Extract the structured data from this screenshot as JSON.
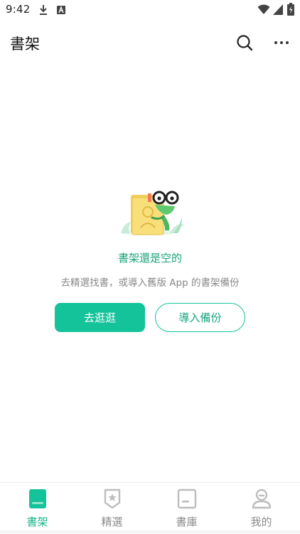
{
  "status_bar": {
    "time": "9:42",
    "icons": [
      "download-icon",
      "a-box-icon",
      "wifi-icon",
      "signal-icon",
      "battery-charging-icon"
    ]
  },
  "header": {
    "title": "書架",
    "search_icon": "search-icon",
    "more_icon": "more-horizontal-icon"
  },
  "empty_state": {
    "title": "書架還是空的",
    "subtitle": "去精選找書，或導入舊版 App 的書架備份",
    "primary_button": "去逛逛",
    "secondary_button": "導入備份"
  },
  "bottom_nav": {
    "items": [
      {
        "label": "書架",
        "icon": "bookshelf-icon",
        "active": true
      },
      {
        "label": "精選",
        "icon": "badge-star-icon",
        "active": false
      },
      {
        "label": "書庫",
        "icon": "library-icon",
        "active": false
      },
      {
        "label": "我的",
        "icon": "profile-icon",
        "active": false
      }
    ]
  },
  "colors": {
    "accent": "#15c39a",
    "accent_text": "#1aa37a",
    "inactive": "#8a8a8a"
  }
}
